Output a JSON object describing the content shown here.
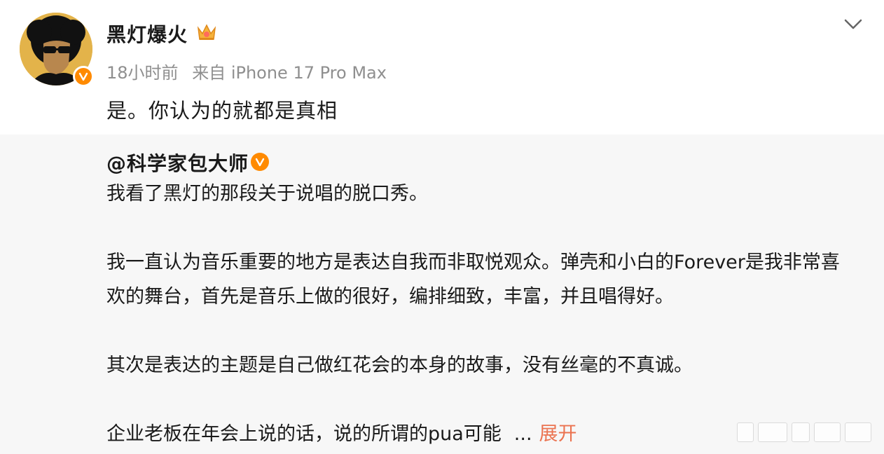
{
  "post": {
    "author": "黑灯爆火",
    "time": "18小时前",
    "source": "来自 iPhone 17 Pro Max",
    "text": "是。你认为的就都是真相"
  },
  "repost": {
    "author": "@科学家包大师",
    "paragraphs": [
      "我看了黑灯的那段关于说唱的脱口秀。",
      "我一直认为音乐重要的地方是表达自我而非取悦观众。弹壳和小白的Forever是我非常喜欢的舞台，首先是音乐上做的很好，编排细致，丰富，并且唱得好。",
      "其次是表达的主题是自己做红花会的本身的故事，没有丝毫的不真诚。",
      "企业老板在年会上说的话，说的所谓的pua可能"
    ],
    "ellipsis": "...",
    "expand_label": "展开"
  },
  "colors": {
    "accent_orange": "#ff8a00",
    "link_orange": "#eb7350",
    "meta_gray": "#8f8f8f",
    "repost_bg": "#f7f7f7"
  },
  "icons": [
    "avatar",
    "crown-icon",
    "verified-icon",
    "chevron-down-icon"
  ]
}
